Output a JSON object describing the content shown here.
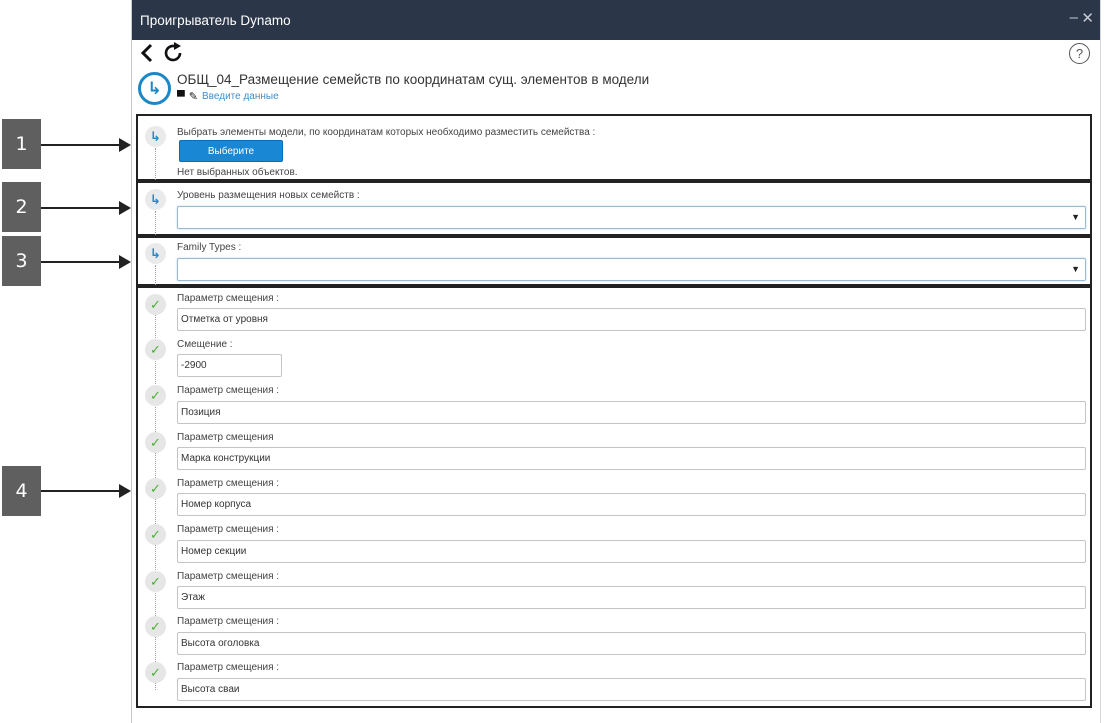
{
  "callouts": [
    "1",
    "2",
    "3",
    "4"
  ],
  "window": {
    "title": "Проигрыватель Dynamo",
    "minimize": "–",
    "close": "✕"
  },
  "toolbar": {
    "back_icon": "back-arrow-icon",
    "refresh_icon": "refresh-icon",
    "help_label": "?"
  },
  "header": {
    "logo_icon": "dynamo-player-icon",
    "script_title": "ОБЩ_04_Размещение семейств по координатам сущ. элементов в модели",
    "input_link": "Введите данные"
  },
  "inputs": {
    "select_elements": {
      "label": "Выбрать элементы модели, по координатам которых необходимо разместить семейства :",
      "button_label": "Выберите",
      "status": "Нет выбранных объектов."
    },
    "level": {
      "label": "Уровень размещения новых семейств :",
      "value": ""
    },
    "family_types": {
      "label": "Family Types :",
      "value": ""
    },
    "parameters": [
      {
        "label": "Параметр смещения :",
        "value": "Отметка от уровня"
      },
      {
        "label": "Смещение :",
        "value": "-2900"
      },
      {
        "label": "Параметр смещения :",
        "value": "Позиция"
      },
      {
        "label": "Параметр смещения",
        "value": "Марка конструкции"
      },
      {
        "label": "Параметр смещения :",
        "value": "Номер корпуса"
      },
      {
        "label": "Параметр смещения :",
        "value": "Номер секции"
      },
      {
        "label": "Параметр смещения :",
        "value": "Этаж"
      },
      {
        "label": "Параметр смещения :",
        "value": "Высота оголовка"
      },
      {
        "label": "Параметр смещения :",
        "value": "Высота сваи"
      }
    ]
  },
  "colors": {
    "titlebar": "#2c3649",
    "accent": "#1a87d4",
    "check": "#4caf3a"
  }
}
